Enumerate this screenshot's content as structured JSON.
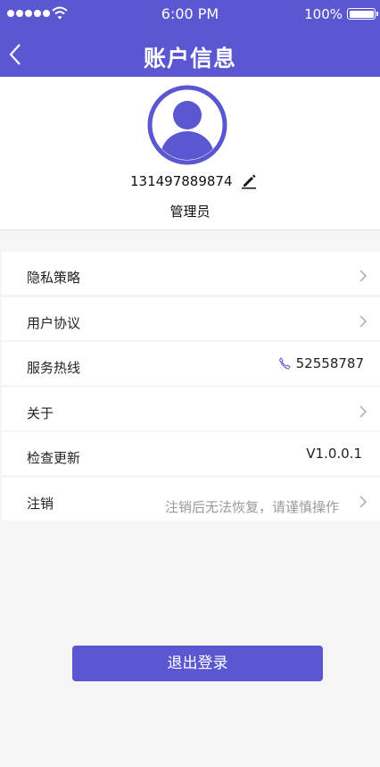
{
  "status_bar": {
    "time": "6:00 PM",
    "battery": "100%"
  },
  "header": {
    "title": "账户信息"
  },
  "profile": {
    "phone": "131497889874",
    "role": "管理员"
  },
  "menu": [
    {
      "label": "隐私策略"
    },
    {
      "label": "用户协议"
    },
    {
      "label": "服务热线",
      "value": "52558787"
    },
    {
      "label": "关于"
    },
    {
      "label": "检查更新",
      "value": "V1.0.0.1"
    },
    {
      "label": "注销",
      "hint": "注销后无法恢复，请谨慎操作"
    }
  ],
  "logout_label": "退出登录",
  "colors": {
    "primary": "#5a57d0",
    "background": "#f5f5f5"
  }
}
